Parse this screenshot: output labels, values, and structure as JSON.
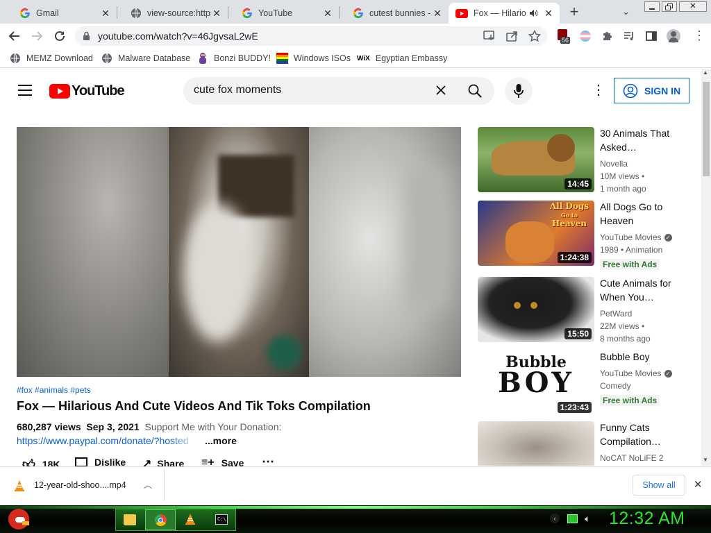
{
  "tabs": [
    {
      "title": "Gmail",
      "icon": "google-g"
    },
    {
      "title": "view-source:https",
      "icon": "globe"
    },
    {
      "title": "YouTube",
      "icon": "google-g"
    },
    {
      "title": "cutest bunnies - G",
      "icon": "google-g"
    },
    {
      "title": "Fox — Hilario",
      "icon": "youtube",
      "active": true,
      "audio": true
    }
  ],
  "address": {
    "url": "youtube.com/watch?v=46JgvsaL2wE"
  },
  "extensions": {
    "badge": "56"
  },
  "bookmarks": [
    {
      "label": "MEMZ Download",
      "icon": "globe"
    },
    {
      "label": "Malware Database",
      "icon": "globe"
    },
    {
      "label": "Bonzi BUDDY!",
      "icon": "bonzi"
    },
    {
      "label": "Windows ISOs",
      "icon": "windows-flag"
    },
    {
      "label": "Egyptian Embassy",
      "icon": "wix"
    }
  ],
  "youtube": {
    "logo_text": "YouTube",
    "search_value": "cute fox moments",
    "sign_in": "SIGN IN",
    "hashtags": "#fox #animals #pets",
    "video_title": "Fox — Hilarious And Cute Videos And Tik Toks Compilation",
    "views": "680,287 views",
    "date": "Sep 3, 2021",
    "desc": "Support Me with Your Donation:",
    "link": "https://www.paypal.com/donate/?hosted",
    "more": "...more",
    "likes": "18K",
    "dislike": "Dislike",
    "share": "Share",
    "save": "Save"
  },
  "related": [
    {
      "title": "30 Animals That Asked…",
      "channel": "Novella",
      "line2": "10M views •",
      "line3": "1 month ago",
      "duration": "14:45"
    },
    {
      "title": "All Dogs Go to Heaven",
      "channel": "YouTube Movies",
      "verified": true,
      "line2": "1989 • Animation",
      "badge": "Free with Ads",
      "duration": "1:24:38",
      "thumb_text1": "All Dogs",
      "thumb_text2": "Heaven",
      "thumb_text_small": "Go to"
    },
    {
      "title": "Cute Animals for When You…",
      "channel": "PetWard",
      "line2": "22M views •",
      "line3": "8 months ago",
      "duration": "15:50"
    },
    {
      "title": "Bubble Boy",
      "channel": "YouTube Movies",
      "verified": true,
      "line2": "Comedy",
      "badge": "Free with Ads",
      "duration": "1:23:43",
      "thumb_text1": "Bubble",
      "thumb_text2": "BOY"
    },
    {
      "title": "Funny Cats Compilation…",
      "channel": "NoCAT NoLiFE 2"
    }
  ],
  "download": {
    "filename": "12-year-old-shoo....mp4",
    "show_all": "Show all"
  },
  "taskbar": {
    "clock": "12:32 AM"
  }
}
